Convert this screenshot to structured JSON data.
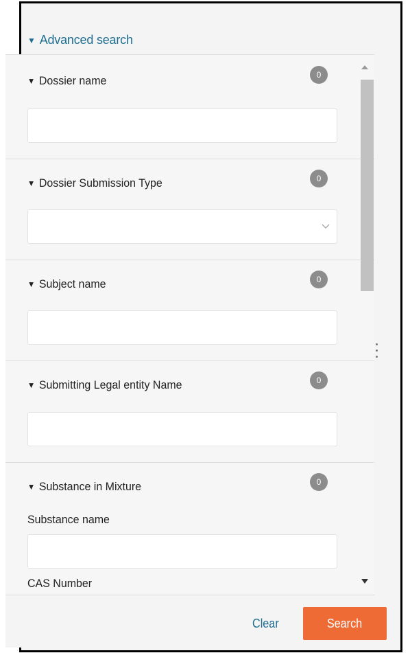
{
  "advanced_search": {
    "label": "Advanced search",
    "toggle_glyph": "▼"
  },
  "sections": [
    {
      "title": "Dossier name",
      "count": "0",
      "field_type": "text",
      "value": ""
    },
    {
      "title": "Dossier Submission Type",
      "count": "0",
      "field_type": "select",
      "value": ""
    },
    {
      "title": "Subject name",
      "count": "0",
      "field_type": "text",
      "value": ""
    },
    {
      "title": "Submitting Legal entity Name",
      "count": "0",
      "field_type": "text",
      "value": ""
    },
    {
      "title": "Substance in Mixture",
      "count": "0",
      "subfields": [
        {
          "label": "Substance name",
          "value": ""
        },
        {
          "label": "CAS Number",
          "value": ""
        }
      ]
    }
  ],
  "footer": {
    "clear_label": "Clear",
    "search_label": "Search"
  },
  "colors": {
    "accent": "#ef6b36",
    "link": "#1f6e8f",
    "badge": "#8c8c8c"
  },
  "icons": {
    "collapse": "triangle-down-icon",
    "dropdown": "chevron-down-icon"
  }
}
